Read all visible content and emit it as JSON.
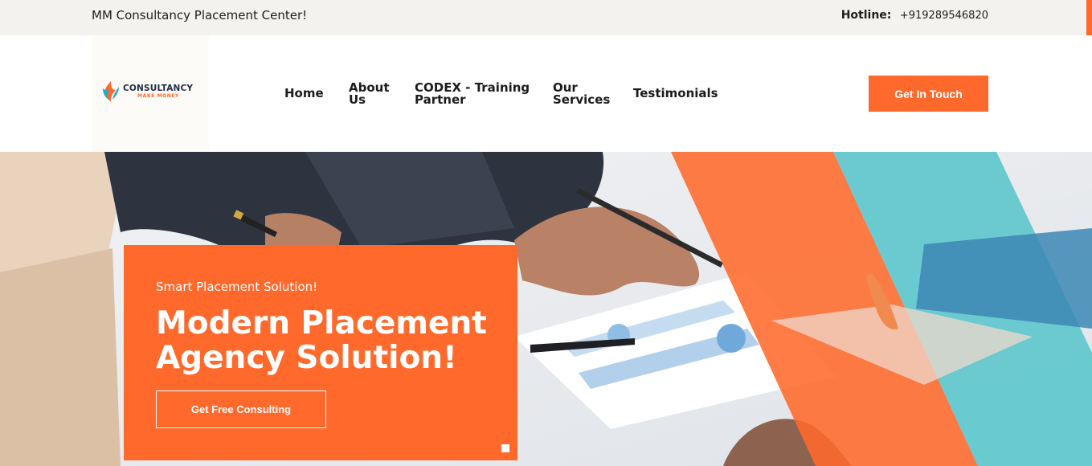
{
  "topbar": {
    "tagline": "MM Consultancy Placement Center!",
    "hotline_label": "Hotline:",
    "hotline_number": "+919289546820"
  },
  "header": {
    "logo": {
      "brand": "CONSULTANCY",
      "subtitle": "MAKE MONEY"
    },
    "nav": [
      {
        "line1": "Home",
        "line2": ""
      },
      {
        "line1": "About",
        "line2": "Us"
      },
      {
        "line1": "CODEX - Training",
        "line2": "Partner"
      },
      {
        "line1": "Our",
        "line2": "Services"
      },
      {
        "line1": "Testimonials",
        "line2": ""
      }
    ],
    "cta_label": "Get In Touch"
  },
  "hero": {
    "kicker": "Smart Placement Solution!",
    "headline_line1": "Modern Placement",
    "headline_line2": "Agency Solution!",
    "button_label": "Get Free Consulting"
  },
  "colors": {
    "accent": "#ff6a2c",
    "teal": "#5cc6cc",
    "dark_text": "#1b1b1b",
    "topbar_bg": "#f4f2ef"
  },
  "icons": [
    "logo-flame-icon",
    "slider-dot-icon"
  ]
}
